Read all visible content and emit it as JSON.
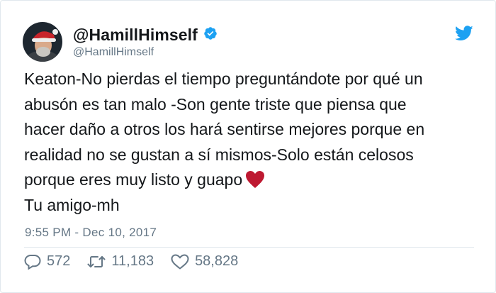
{
  "tweet": {
    "display_name": "@HamillHimself",
    "handle": "@HamillHimself",
    "text": "Keaton-No pierdas el tiempo preguntándote por qué un\nabusón es tan malo -Son gente triste que piensa que\nhacer daño a otros los hará sentirse mejores porque en\nrealidad no se gustan a sí mismos-Solo están celosos\nporque eres muy listo y guapo",
    "signoff": "Tu amigo-mh",
    "timestamp": "9:55 PM - Dec 10, 2017",
    "replies": "572",
    "retweets": "11,183",
    "likes": "58,828"
  },
  "colors": {
    "text": "#14171a",
    "muted": "#657786",
    "brand_blue": "#1da1f2",
    "heart_red": "#be1931"
  },
  "icons": {
    "verified": "verified-badge-icon",
    "bird": "twitter-bird-icon",
    "reply": "reply-icon",
    "retweet": "retweet-icon",
    "like": "heart-outline-icon",
    "emoji": "red-heart-emoji-icon"
  }
}
